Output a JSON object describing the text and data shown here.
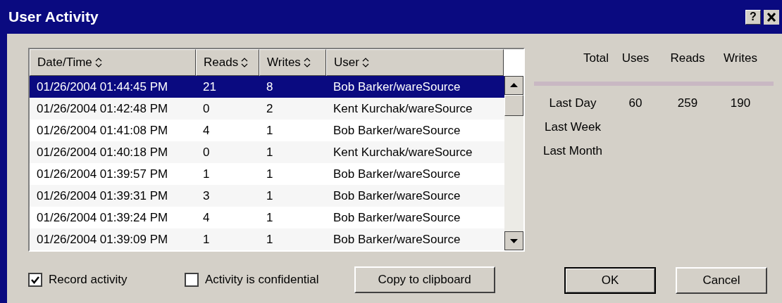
{
  "window": {
    "title": "User Activity",
    "help_button": "?"
  },
  "table": {
    "columns": [
      "Date/Time",
      "Reads",
      "Writes",
      "User"
    ],
    "rows": [
      {
        "cells": [
          "01/26/2004 01:44:45 PM",
          "21",
          "8",
          "Bob Barker/wareSource"
        ],
        "selected": true
      },
      {
        "cells": [
          "01/26/2004 01:42:48 PM",
          "0",
          "2",
          "Kent Kurchak/wareSource"
        ],
        "selected": false
      },
      {
        "cells": [
          "01/26/2004 01:41:08 PM",
          "4",
          "1",
          "Bob Barker/wareSource"
        ],
        "selected": false
      },
      {
        "cells": [
          "01/26/2004 01:40:18 PM",
          "0",
          "1",
          "Kent Kurchak/wareSource"
        ],
        "selected": false
      },
      {
        "cells": [
          "01/26/2004 01:39:57 PM",
          "1",
          "1",
          "Bob Barker/wareSource"
        ],
        "selected": false
      },
      {
        "cells": [
          "01/26/2004 01:39:31 PM",
          "3",
          "1",
          "Bob Barker/wareSource"
        ],
        "selected": false
      },
      {
        "cells": [
          "01/26/2004 01:39:24 PM",
          "4",
          "1",
          "Bob Barker/wareSource"
        ],
        "selected": false
      },
      {
        "cells": [
          "01/26/2004 01:39:09 PM",
          "1",
          "1",
          "Bob Barker/wareSource"
        ],
        "selected": false
      }
    ]
  },
  "summary": {
    "columns": [
      "Total",
      "Uses",
      "Reads",
      "Writes"
    ],
    "rows": [
      {
        "label": "Last Day",
        "values": [
          "60",
          "259",
          "190"
        ]
      },
      {
        "label": "Last Week",
        "values": []
      },
      {
        "label": "Last Month",
        "values": []
      }
    ]
  },
  "checkboxes": [
    {
      "label": "Record activity",
      "checked": true
    },
    {
      "label": "Activity is confidential",
      "checked": false
    }
  ],
  "buttons": [
    "Copy to clipboard",
    "OK",
    "Cancel"
  ]
}
